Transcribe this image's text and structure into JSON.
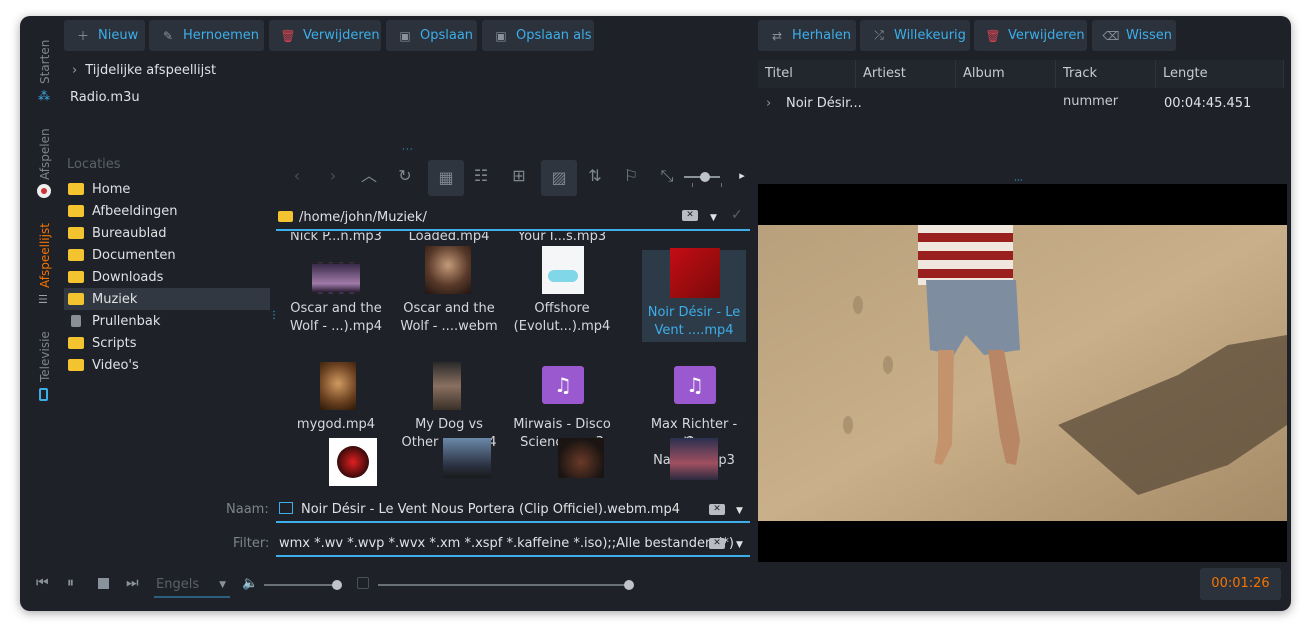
{
  "sidebar_tabs": {
    "starten": "Starten",
    "afspelen": "Afspelen",
    "afspeellijst": "Afspeellijst",
    "televisie": "Televisie"
  },
  "toolbar_left": {
    "nieuw": "Nieuw",
    "hernoemen": "Hernoemen",
    "verwijderen": "Verwijderen",
    "opslaan": "Opslaan",
    "opslaan_als": "Opslaan als"
  },
  "toolbar_right": {
    "herhalen": "Herhalen",
    "willekeurig": "Willekeurig",
    "verwijderen": "Verwijderen",
    "wissen": "Wissen"
  },
  "playlists": {
    "tree_item": "Tijdelijke afspeellijst",
    "file_item": "Radio.m3u"
  },
  "locations": {
    "heading": "Locaties",
    "items": [
      "Home",
      "Afbeeldingen",
      "Bureaublad",
      "Documenten",
      "Downloads",
      "Muziek",
      "Prullenbak",
      "Scripts",
      "Video's"
    ]
  },
  "path": "/home/john/Muziek/",
  "files": {
    "cut_row": [
      "Nick P...n.mp3",
      "Loaded.mp4",
      "Your I...s.mp3"
    ],
    "row1": [
      {
        "l1": "Oscar and the",
        "l2": "Wolf - ...).mp4"
      },
      {
        "l1": "Oscar and the",
        "l2": "Wolf - ....webm"
      },
      {
        "l1": "Offshore",
        "l2": "(Evolut...).mp4"
      },
      {
        "l1": "Noir Désir - Le",
        "l2": "Vent ....mp4"
      }
    ],
    "row2": [
      {
        "l1": "mygod.mp4",
        "l2": ""
      },
      {
        "l1": "My Dog vs",
        "l2": "Other ...g.mp4"
      },
      {
        "l1": "Mirwais - Disco",
        "l2": "Science.mp3"
      },
      {
        "l1": "Max Richter - On",
        "l2": "the Nat...ht.mp3"
      }
    ]
  },
  "naam": {
    "label": "Naam:",
    "value": "Noir Désir - Le Vent Nous Portera (Clip Officiel).webm.mp4"
  },
  "filter": {
    "label": "Filter:",
    "value": "wmx *.wv *.wvp *.wvx *.xm *.xspf *.kaffeine *.iso);;Alle bestanden (*)"
  },
  "table": {
    "headers": [
      "Titel",
      "Artiest",
      "Album",
      "Track nummer",
      "Lengte"
    ],
    "row": {
      "title": "Noir Désir...",
      "length": "00:04:45.451"
    }
  },
  "bottom": {
    "language": "Engels",
    "time": "00:01:26"
  },
  "colors": {
    "accent": "#3daee9",
    "active_tab": "#f67400",
    "window_bg": "#1e2128",
    "button_bg": "#2b323c"
  }
}
